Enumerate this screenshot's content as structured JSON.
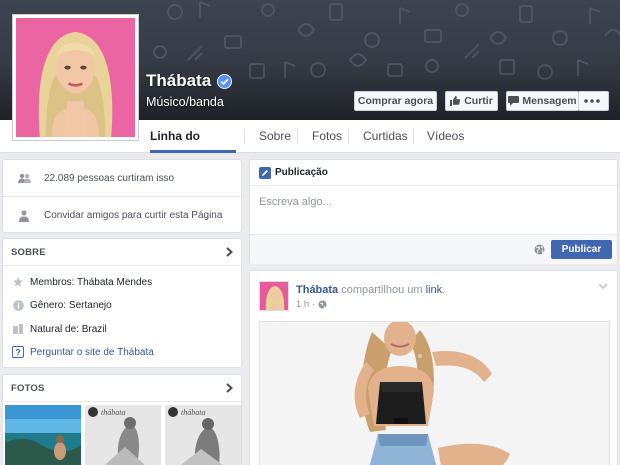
{
  "page": {
    "name": "Thábata",
    "category": "Músico/banda",
    "verified_icon": "verified-badge-icon"
  },
  "cover_actions": {
    "shop": "Comprar agora",
    "like": "Curtir",
    "message": "Mensagem",
    "more_icon": "more-dots-icon"
  },
  "tabs": [
    "Linha do Tempo",
    "Sobre",
    "Fotos",
    "Curtidas",
    "Vídeos"
  ],
  "likes_card": {
    "likes_text": "22.089 pessoas curtiram isso",
    "invite_text": "Convidar amigos para curtir esta Página"
  },
  "about": {
    "header": "SOBRE",
    "members": "Membros: Thábata Mendes",
    "genre": "Gênero: Sertanejo",
    "hometown": "Natural de: Brazil",
    "site_link": "Perguntar o site de Thábata"
  },
  "photos": {
    "header": "FOTOS",
    "watermark": "thábata"
  },
  "composer": {
    "tab_label": "Publicação",
    "placeholder": "Escreva algo...",
    "publish_label": "Publicar"
  },
  "post": {
    "author": "Thábata",
    "action_text": "compartilhou um",
    "link_text": "link",
    "time": "1 h ·"
  },
  "colors": {
    "brand_blue": "#4267b2",
    "link_blue": "#365899",
    "cover_bg": "#3a404b",
    "profile_bg": "#e85a9c"
  }
}
